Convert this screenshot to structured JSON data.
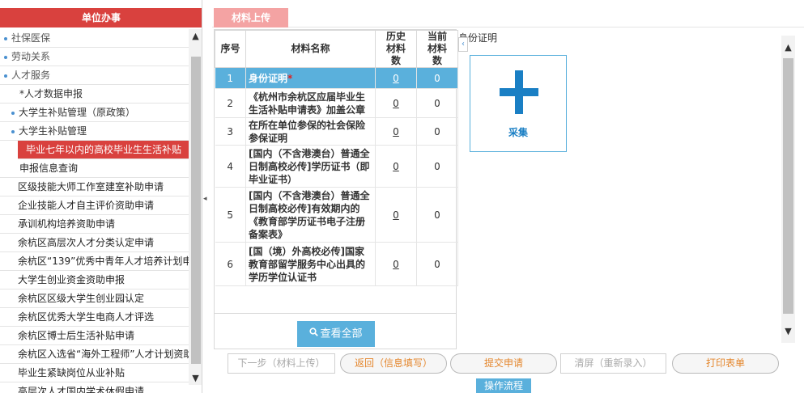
{
  "sidebar": {
    "title": "单位办事",
    "items": [
      {
        "label": "社保医保",
        "level": 0
      },
      {
        "label": "劳动关系",
        "level": 0
      },
      {
        "label": "人才服务",
        "level": 0
      },
      {
        "label": "*人才数据申报",
        "level": 3
      },
      {
        "label": "大学生补贴管理（原政策）",
        "level": 1
      },
      {
        "label": "大学生补贴管理",
        "level": 1
      },
      {
        "label": "毕业七年以内的高校毕业生生活补贴",
        "level": "active"
      },
      {
        "label": "申报信息查询",
        "level": 2
      },
      {
        "label": "区级技能大师工作室建室补助申请",
        "level": "plain"
      },
      {
        "label": "企业技能人才自主评价资助申请",
        "level": "plain"
      },
      {
        "label": "承训机构培养资助申请",
        "level": "plain"
      },
      {
        "label": "余杭区高层次人才分类认定申请",
        "level": "plain"
      },
      {
        "label": "余杭区“139”优秀中青年人才培养计划申",
        "level": "plain"
      },
      {
        "label": "大学生创业资金资助申报",
        "level": "plain"
      },
      {
        "label": "余杭区区级大学生创业园认定",
        "level": "plain"
      },
      {
        "label": "余杭区优秀大学生电商人才评选",
        "level": "plain"
      },
      {
        "label": "余杭区博士后生活补贴申请",
        "level": "plain"
      },
      {
        "label": "余杭区入选省“海外工程师”人才计划资助",
        "level": "plain"
      },
      {
        "label": "毕业生紧缺岗位从业补贴",
        "level": "plain"
      },
      {
        "label": "高层次人才国内学术休假申请",
        "level": "plain"
      }
    ],
    "scroll_up": "▲",
    "scroll_down": "▼"
  },
  "main": {
    "tab": "材料上传",
    "table": {
      "headers": {
        "no": "序号",
        "name": "材料名称",
        "history": "历史材料数",
        "current": "当前材料数"
      },
      "rows": [
        {
          "no": "1",
          "name": "身份证明",
          "required": "*",
          "history": "0",
          "current": "0",
          "selected": true
        },
        {
          "no": "2",
          "name": "《杭州市余杭区应届毕业生生活补贴申请表》加盖公章",
          "required": "",
          "history": "0",
          "current": "0"
        },
        {
          "no": "3",
          "name": "在所在单位参保的社会保险参保证明",
          "required": "",
          "history": "0",
          "current": "0"
        },
        {
          "no": "4",
          "name": "[国内（不含港澳台）普通全日制高校必传]学历证书（即毕业证书）",
          "required": "",
          "history": "0",
          "current": "0"
        },
        {
          "no": "5",
          "name": "[国内（不含港澳台）普通全日制高校必传]有效期内的《教育部学历证书电子注册备案表》",
          "required": "",
          "history": "0",
          "current": "0"
        },
        {
          "no": "6",
          "name": "[国（境）外高校必传]国家教育部留学服务中心出具的学历学位认证书",
          "required": "",
          "history": "0",
          "current": "0"
        }
      ]
    },
    "view_all": "查看全部",
    "view_all_icon": "search-icon",
    "preview": {
      "title": "身份证明",
      "collapse": "‹",
      "capture_label": "采集",
      "capture_icon": "plus-icon"
    },
    "scroll_up": "▲",
    "scroll_down": "▼",
    "collapse_handle": "◂"
  },
  "actions": {
    "next": "下一步（材料上传）",
    "back": "返回（信息填写）",
    "submit": "提交申请",
    "clear": "清屏（重新录入）",
    "print": "打印表单",
    "flow": "操作流程"
  },
  "colors": {
    "header_red": "#d9413e",
    "tab_pink": "#f4a3a3",
    "selection_blue": "#5ab0dc",
    "icon_blue": "#1a7fc4",
    "action_orange": "#e4862c"
  }
}
